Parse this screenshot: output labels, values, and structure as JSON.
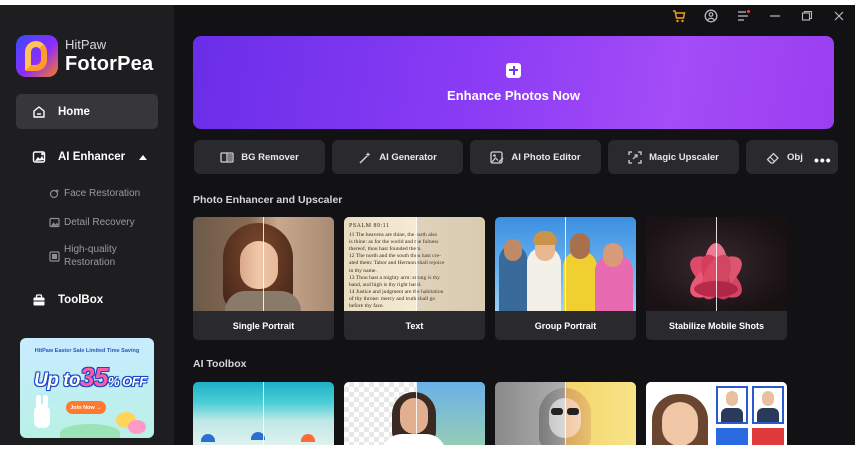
{
  "brand": {
    "sub": "HitPaw",
    "main": "FotorPea"
  },
  "sidebar": {
    "home": "Home",
    "ai_enhancer": "AI Enhancer",
    "sub_items": [
      "Face Restoration",
      "Detail Recovery",
      "High-quality\nRestoration"
    ],
    "toolbox": "ToolBox"
  },
  "promo": {
    "top": "HitPaw Easter Sale Limited Time Saving",
    "big_prefix": "Up to",
    "big_num": "35",
    "big_suffix": "% OFF",
    "button": "Join Now →"
  },
  "hero": {
    "label": "Enhance Photos Now"
  },
  "tools": [
    "BG Remover",
    "AI Generator",
    "AI Photo Editor",
    "Magic Upscaler",
    "Obj"
  ],
  "sections": {
    "enhancer": "Photo Enhancer and Upscaler",
    "toolbox": "AI Toolbox"
  },
  "enhancer_cards": [
    "Single Portrait",
    "Text",
    "Group Portrait",
    "Stabilize Mobile Shots"
  ],
  "doc": {
    "heading": "PSALM 89:11",
    "lines": [
      "11 The heavens are thine, the earth also",
      "is thine: as for the world and the fulness",
      "thereof, thou hast founded them.",
      "12 The north and the south thou hast cre-",
      "ated them: Tabor and Hermon shall rejoice",
      "in thy name.",
      "13 Thou hast a mighty arm: strong is thy",
      "hand, and high is thy right hand.",
      "14 Justice and judgment are the habitation",
      "of thy throne: mercy and truth shall go",
      "before thy face."
    ]
  },
  "colors": {
    "accent": "#8b3cf5",
    "sidebar": "#1e1e21",
    "bg": "#121214",
    "card": "#2a2a2e"
  }
}
